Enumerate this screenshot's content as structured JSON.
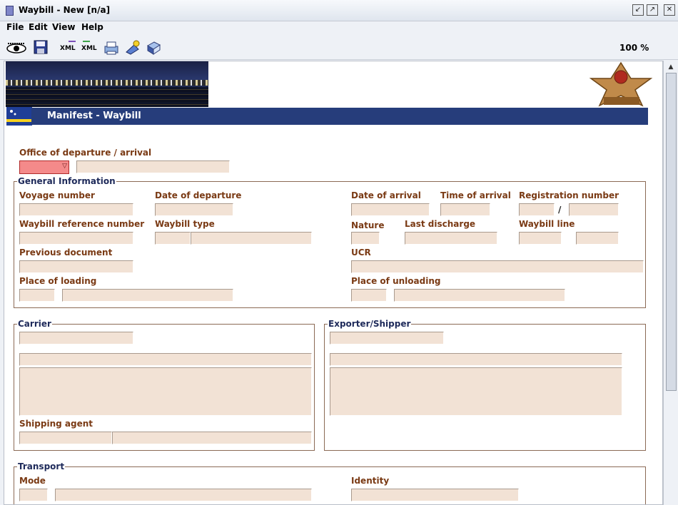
{
  "window": {
    "title": "Waybill - New [n/a]"
  },
  "menu": [
    "File",
    "Edit",
    "View",
    "Help"
  ],
  "toolbar": {
    "zoom": "100 %",
    "icons": [
      "view-icon",
      "save-icon",
      "xml-export-icon",
      "xml-import-icon",
      "print-icon",
      "verify-icon",
      "help-book-icon"
    ],
    "xml_label": "XML"
  },
  "form": {
    "header": "Manifest - Waybill",
    "office_label": "Office of departure / arrival",
    "general": {
      "legend": "General Information",
      "voyage_number": "Voyage number",
      "date_departure": "Date of departure",
      "date_arrival": "Date of arrival",
      "time_arrival": "Time of arrival",
      "registration_number": "Registration number",
      "slash": "/",
      "waybill_reference": "Waybill reference number",
      "waybill_type": "Waybill type",
      "nature": "Nature",
      "last_discharge": "Last discharge",
      "waybill_line": "Waybill line",
      "previous_document": "Previous document",
      "ucr": "UCR",
      "place_loading": "Place of loading",
      "place_unloading": "Place of unloading"
    },
    "carrier": {
      "legend": "Carrier",
      "shipping_agent": "Shipping agent"
    },
    "exporter": {
      "legend": "Exporter/Shipper"
    },
    "transport": {
      "legend": "Transport",
      "mode": "Mode",
      "identity": "Identity"
    }
  },
  "colors": {
    "header_bar": "#263d7b",
    "label": "#7a3a14",
    "field": "#f2e2d5",
    "required": "#f48a8a"
  }
}
